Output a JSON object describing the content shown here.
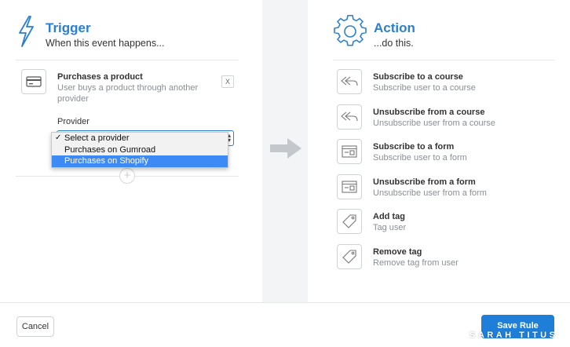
{
  "trigger": {
    "title": "Trigger",
    "subtitle": "When this event happens...",
    "item": {
      "title": "Purchases a product",
      "description": "User buys a product through another provider",
      "remove_label": "X"
    },
    "provider_label": "Provider",
    "provider_dropdown": {
      "options": [
        "Select a provider",
        "Purchases on Gumroad",
        "Purchases on Shopify"
      ],
      "checked": "Select a provider",
      "highlighted": "Purchases on Shopify"
    },
    "add_label": "+"
  },
  "action": {
    "title": "Action",
    "subtitle": "...do this.",
    "items": [
      {
        "title": "Subscribe to a course",
        "description": "Subscribe user to a course",
        "icon": "reply-all-icon"
      },
      {
        "title": "Unsubscribe from a course",
        "description": "Unsubscribe user from a course",
        "icon": "reply-all-icon"
      },
      {
        "title": "Subscribe to a form",
        "description": "Subscribe user to a form",
        "icon": "form-icon"
      },
      {
        "title": "Unsubscribe from a form",
        "description": "Unsubscribe user from a form",
        "icon": "form-icon"
      },
      {
        "title": "Add tag",
        "description": "Tag user",
        "icon": "tag-icon"
      },
      {
        "title": "Remove tag",
        "description": "Remove tag from user",
        "icon": "tag-icon"
      }
    ]
  },
  "footer": {
    "cancel_label": "Cancel",
    "save_label": "Save Rule"
  },
  "watermark": "SARAH TITUS",
  "colors": {
    "accent": "#2a7fd4",
    "save_button": "#1f7fd8",
    "highlight": "#3d89f6"
  }
}
